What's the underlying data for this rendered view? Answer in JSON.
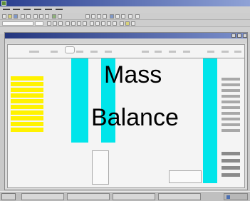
{
  "overlay": {
    "line1": "Mass",
    "line2": "Balance"
  }
}
